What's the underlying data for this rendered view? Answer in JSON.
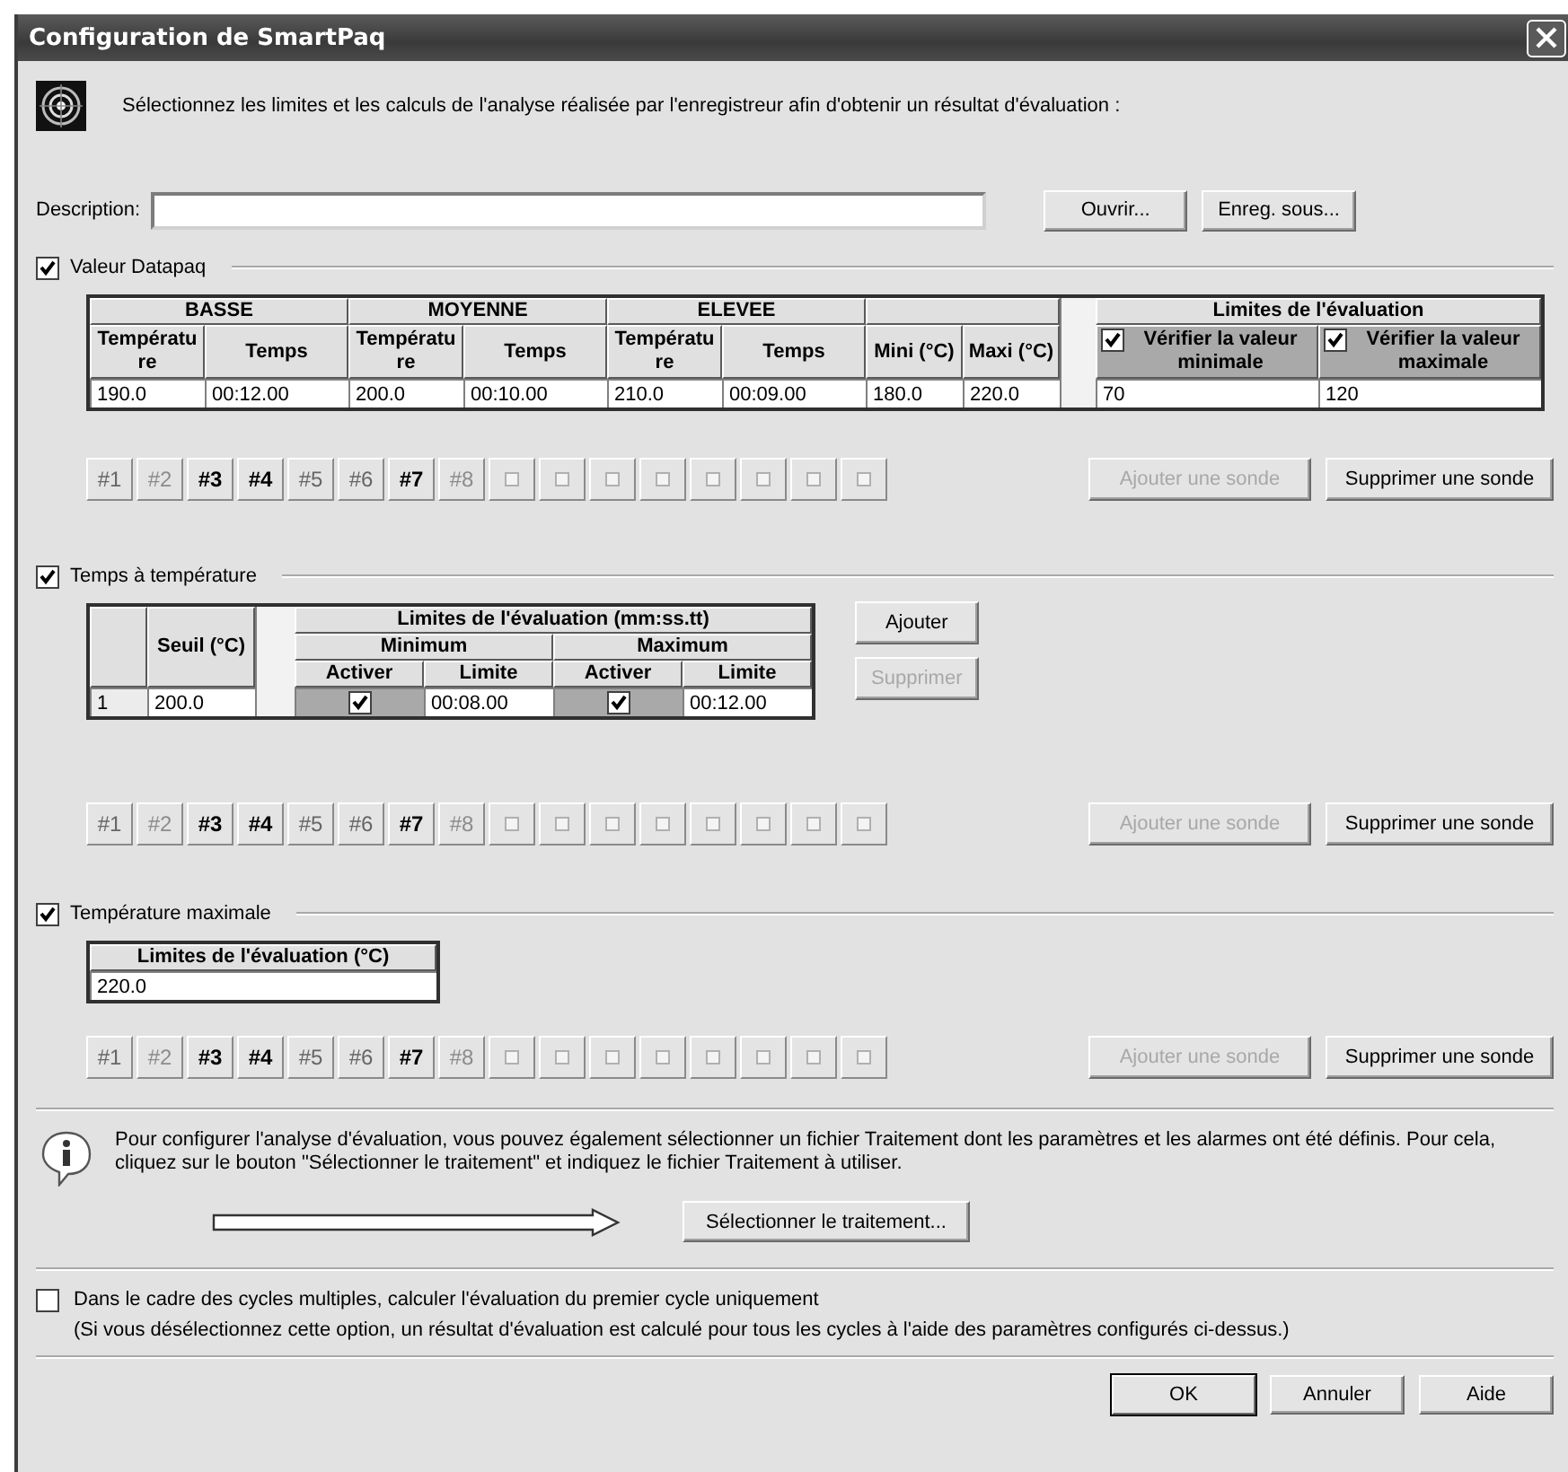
{
  "window": {
    "title": "Configuration de SmartPaq"
  },
  "intro": "Sélectionnez les limites et les calculs de l'analyse réalisée par l'enregistreur afin d'obtenir un résultat d'évaluation :",
  "description": {
    "label": "Description:"
  },
  "file_buttons": [
    "Ouvrir...",
    "Enreg. sous..."
  ],
  "valeur_datapaq": {
    "label": "Valeur Datapaq",
    "checked": true,
    "table": {
      "groups": [
        {
          "title": "BASSE",
          "columns": [
            "Température",
            "Temps"
          ]
        },
        {
          "title": "MOYENNE",
          "columns": [
            "Température",
            "Temps"
          ]
        },
        {
          "title": "ELEVEE",
          "columns": [
            "Température",
            "Temps"
          ]
        },
        {
          "columns": [
            "Mini (°C)",
            "Maxi (°C)"
          ]
        }
      ],
      "limits": {
        "title": "Limites de l'évaluation",
        "checks": [
          {
            "label": "Vérifier la valeur minimale",
            "checked": true
          },
          {
            "label": "Vérifier la valeur maximale",
            "checked": true
          }
        ]
      },
      "row": [
        "190.0",
        "00:12.00",
        "200.0",
        "00:10.00",
        "210.0",
        "00:09.00",
        "180.0",
        "220.0",
        "70",
        "120"
      ]
    },
    "probes": [
      {
        "kind": "numbered",
        "label": "#1",
        "selected": false,
        "disabled": false
      },
      {
        "kind": "numbered",
        "label": "#2",
        "selected": false,
        "disabled": true
      },
      {
        "kind": "numbered",
        "label": "#3",
        "selected": true,
        "disabled": false
      },
      {
        "kind": "numbered",
        "label": "#4",
        "selected": true,
        "disabled": false
      },
      {
        "kind": "numbered",
        "label": "#5",
        "selected": false,
        "disabled": false
      },
      {
        "kind": "numbered",
        "label": "#6",
        "selected": false,
        "disabled": false
      },
      {
        "kind": "numbered",
        "label": "#7",
        "selected": true,
        "disabled": false
      },
      {
        "kind": "numbered",
        "label": "#8",
        "selected": false,
        "disabled": true
      },
      {
        "kind": "empty"
      },
      {
        "kind": "empty"
      },
      {
        "kind": "empty"
      },
      {
        "kind": "empty"
      },
      {
        "kind": "empty"
      },
      {
        "kind": "empty"
      },
      {
        "kind": "empty"
      },
      {
        "kind": "empty"
      }
    ],
    "add_probe": {
      "label": "Ajouter une sonde",
      "disabled": true
    },
    "remove_probe": {
      "label": "Supprimer une sonde",
      "disabled": false
    }
  },
  "temps_a_temperature": {
    "label": "Temps à température",
    "checked": true,
    "table": {
      "threshold": "Seuil (°C)",
      "limits_title": "Limites de l'évaluation (mm:ss.tt)",
      "groups": [
        {
          "title": "Minimum",
          "columns": [
            "Activer",
            "Limite"
          ]
        },
        {
          "title": "Maximum",
          "columns": [
            "Activer",
            "Limite"
          ]
        }
      ],
      "rows": [
        {
          "index": "1",
          "threshold": "200.0",
          "limits": [
            {
              "enabled": true,
              "value": "00:08.00"
            },
            {
              "enabled": true,
              "value": "00:12.00"
            }
          ]
        }
      ]
    },
    "add_button": {
      "label": "Ajouter",
      "disabled": false
    },
    "remove_button": {
      "label": "Supprimer",
      "disabled": true
    },
    "probes": [
      {
        "kind": "numbered",
        "label": "#1",
        "selected": false,
        "disabled": false
      },
      {
        "kind": "numbered",
        "label": "#2",
        "selected": false,
        "disabled": true
      },
      {
        "kind": "numbered",
        "label": "#3",
        "selected": true,
        "disabled": false
      },
      {
        "kind": "numbered",
        "label": "#4",
        "selected": true,
        "disabled": false
      },
      {
        "kind": "numbered",
        "label": "#5",
        "selected": false,
        "disabled": false
      },
      {
        "kind": "numbered",
        "label": "#6",
        "selected": false,
        "disabled": false
      },
      {
        "kind": "numbered",
        "label": "#7",
        "selected": true,
        "disabled": false
      },
      {
        "kind": "numbered",
        "label": "#8",
        "selected": false,
        "disabled": true
      },
      {
        "kind": "empty"
      },
      {
        "kind": "empty"
      },
      {
        "kind": "empty"
      },
      {
        "kind": "empty"
      },
      {
        "kind": "empty"
      },
      {
        "kind": "empty"
      },
      {
        "kind": "empty"
      },
      {
        "kind": "empty"
      }
    ],
    "add_probe": {
      "label": "Ajouter une sonde",
      "disabled": true
    },
    "remove_probe": {
      "label": "Supprimer une sonde",
      "disabled": false
    }
  },
  "temperature_maximale": {
    "label": "Température maximale",
    "checked": true,
    "table": {
      "title": "Limites de l'évaluation (°C)",
      "value": "220.0"
    },
    "probes": [
      {
        "kind": "numbered",
        "label": "#1",
        "selected": false,
        "disabled": false
      },
      {
        "kind": "numbered",
        "label": "#2",
        "selected": false,
        "disabled": true
      },
      {
        "kind": "numbered",
        "label": "#3",
        "selected": true,
        "disabled": false
      },
      {
        "kind": "numbered",
        "label": "#4",
        "selected": true,
        "disabled": false
      },
      {
        "kind": "numbered",
        "label": "#5",
        "selected": false,
        "disabled": false
      },
      {
        "kind": "numbered",
        "label": "#6",
        "selected": false,
        "disabled": false
      },
      {
        "kind": "numbered",
        "label": "#7",
        "selected": true,
        "disabled": false
      },
      {
        "kind": "numbered",
        "label": "#8",
        "selected": false,
        "disabled": true
      },
      {
        "kind": "empty"
      },
      {
        "kind": "empty"
      },
      {
        "kind": "empty"
      },
      {
        "kind": "empty"
      },
      {
        "kind": "empty"
      },
      {
        "kind": "empty"
      },
      {
        "kind": "empty"
      },
      {
        "kind": "empty"
      }
    ],
    "add_probe": {
      "label": "Ajouter une sonde",
      "disabled": true
    },
    "remove_probe": {
      "label": "Supprimer une sonde",
      "disabled": false
    }
  },
  "info": {
    "text": "Pour configurer l'analyse d'évaluation, vous pouvez également sélectionner un fichier Traitement dont les paramètres et les alarmes ont été définis. Pour cela, cliquez sur le bouton \"Sélectionner le traitement\" et indiquez le fichier Traitement à utiliser.",
    "button": "Sélectionner le traitement..."
  },
  "first_cycle_option": {
    "label": "Dans le cadre des cycles multiples, calculer l'évaluation du premier cycle uniquement",
    "checked": false,
    "note": "(Si vous désélectionnez cette option, un résultat d'évaluation est calculé pour tous les cycles à l'aide des paramètres configurés ci-dessus.)"
  },
  "footer_buttons": [
    {
      "label": "OK",
      "default": true
    },
    {
      "label": "Annuler",
      "default": false
    },
    {
      "label": "Aide",
      "default": false
    }
  ]
}
